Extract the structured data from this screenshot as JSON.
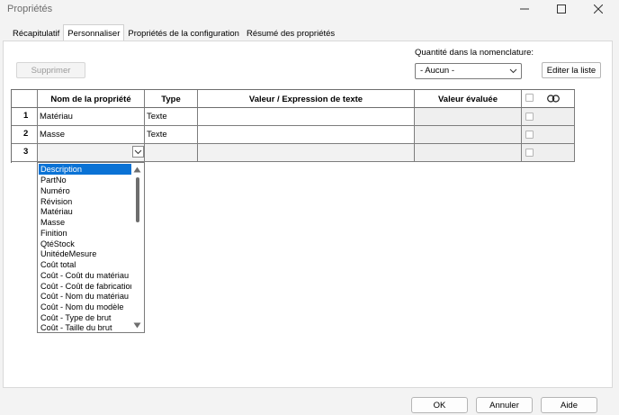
{
  "window": {
    "title": "Propriétés"
  },
  "tabs": [
    {
      "label": "Récapitulatif"
    },
    {
      "label": "Personnaliser"
    },
    {
      "label": "Propriétés de la configuration"
    },
    {
      "label": "Résumé des propriétés"
    }
  ],
  "toolbar": {
    "delete_label": "Supprimer",
    "bom_qty_label": "Quantité dans la nomenclature:",
    "bom_qty_value": "- Aucun -",
    "edit_list_label": "Editer la liste"
  },
  "table": {
    "headers": [
      "Nom de la propriété",
      "Type",
      "Valeur / Expression de texte",
      "Valeur évaluée"
    ],
    "rows": [
      {
        "num": "1",
        "name": "Matériau",
        "type": "Texte",
        "value": "",
        "evaluated": ""
      },
      {
        "num": "2",
        "name": "Masse",
        "type": "Texte",
        "value": "",
        "evaluated": ""
      },
      {
        "num": "3",
        "name": "",
        "type": "",
        "value": "",
        "evaluated": ""
      }
    ]
  },
  "dropdown": {
    "items": [
      "Description",
      "PartNo",
      "Numéro",
      "Révision",
      "Matériau",
      "Masse",
      "Finition",
      "QtéStock",
      "UnitédeMesure",
      "Coût total",
      "Coût - Coût du matériau",
      "Coût - Coût de fabrication",
      "Coût - Nom du matériau",
      "Coût - Nom du modèle",
      "Coût - Type de brut",
      "Coût - Taille du brut"
    ],
    "selected_index": 0
  },
  "footer": {
    "ok_label": "OK",
    "cancel_label": "Annuler",
    "help_label": "Aide"
  },
  "colors": {
    "selection": "#0a72d5",
    "evaluated_bg": "#efefef"
  }
}
